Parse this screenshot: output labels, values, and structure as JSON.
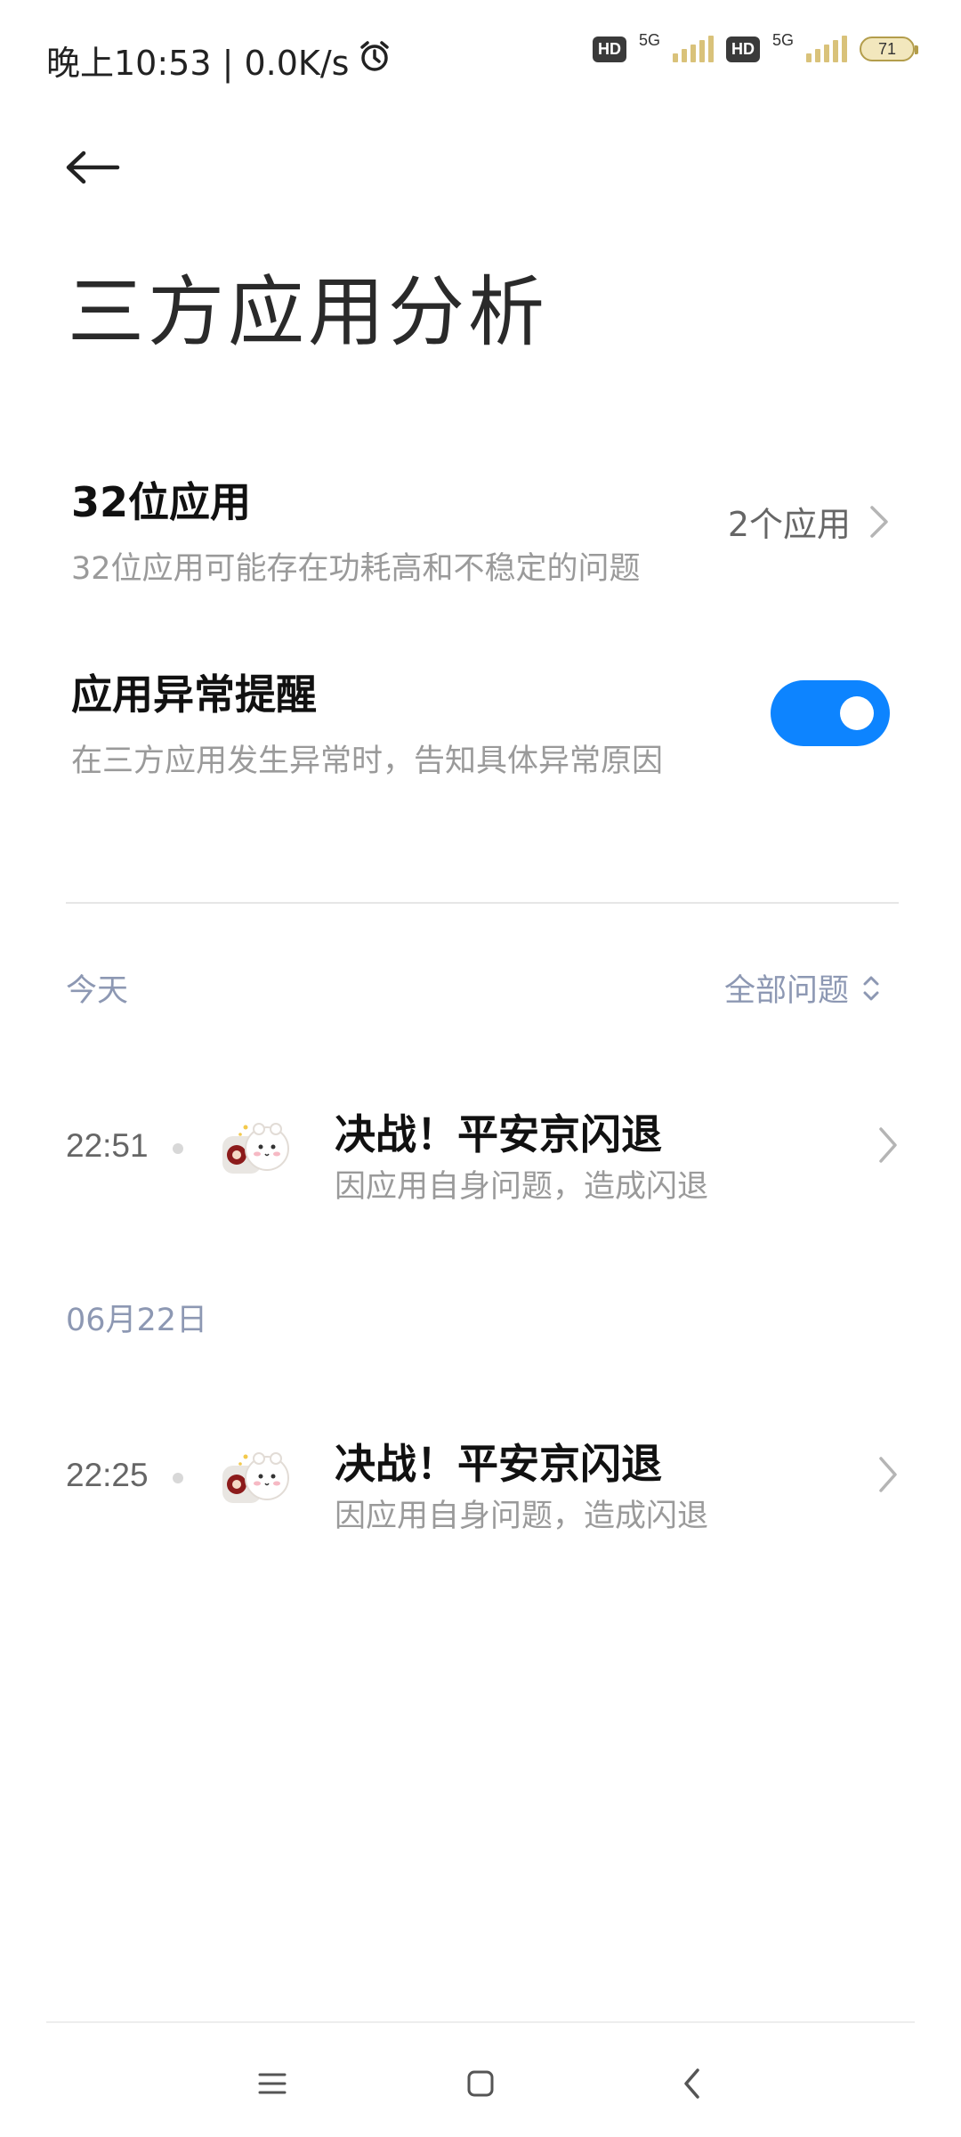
{
  "status_bar": {
    "time": "晚上10:53 | 0.0K/s",
    "alarm_icon": "alarm-clock-icon",
    "hd_badge": "HD",
    "network_type": "5G",
    "battery_level": "71",
    "battery_percent": 71,
    "colors": {
      "signal": "#d9c27a",
      "battery_fill": "#f2e7bd"
    }
  },
  "header": {
    "back_icon": "arrow-left-icon",
    "title": "三方应用分析"
  },
  "settings": {
    "app32": {
      "title": "32位应用",
      "subtitle": "32位应用可能存在功耗高和不稳定的问题",
      "count": "2个应用"
    },
    "abnormal_reminder": {
      "title": "应用异常提醒",
      "subtitle": "在三方应用发生异常时，告知具体异常原因",
      "enabled": true,
      "toggle_color": "#0d84ff"
    }
  },
  "sections": [
    {
      "header": "今天",
      "filter_label": "全部问题",
      "events": [
        {
          "time": "22:51",
          "title": "决战！平安京闪退",
          "subtitle": "因应用自身问题，造成闪退"
        }
      ]
    },
    {
      "header": "06月22日",
      "events": [
        {
          "time": "22:25",
          "title": "决战！平安京闪退",
          "subtitle": "因应用自身问题，造成闪退"
        }
      ]
    }
  ],
  "nav_bar": {
    "menu_icon": "menu-icon",
    "home_icon": "home-square-icon",
    "back_icon": "back-chevron-icon"
  },
  "colors": {
    "section_text": "#8d98b3",
    "accent": "#0d84ff"
  }
}
